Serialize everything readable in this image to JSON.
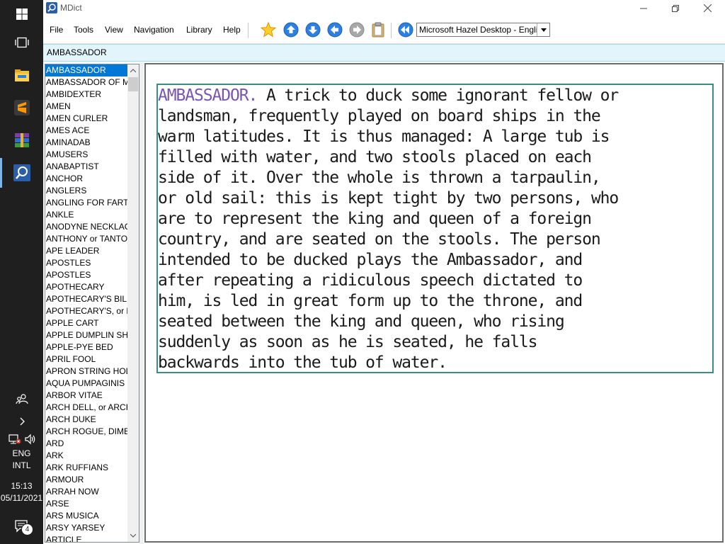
{
  "taskbar": {
    "clock_time": "15:13",
    "clock_date": "05/11/2021",
    "language_1": "ENG",
    "language_2": "INTL",
    "notification_count": "4"
  },
  "window": {
    "title": "MDict"
  },
  "menu": [
    "File",
    "Tools",
    "View",
    "Navigation",
    "Library",
    "Help"
  ],
  "toolbar": {
    "dictionary_selected": "Microsoft Hazel Desktop - English"
  },
  "search": {
    "value": "AMBASSADOR"
  },
  "wordlist": [
    "AMBASSADOR",
    "AMBASSADOR OF MOROCCO",
    "AMBIDEXTER",
    "AMEN",
    "AMEN CURLER",
    "AMES ACE",
    "AMINADAB",
    "AMUSERS",
    "ANABAPTIST",
    "ANCHOR",
    "ANGLERS",
    "ANGLING FOR FARTHINGS",
    "ANKLE",
    "ANODYNE NECKLACE",
    "ANTHONY or TANTONY PIG",
    "APE LEADER",
    "APOSTLES",
    "APOSTLES",
    "APOTHECARY",
    "APOTHECARY'S BILL",
    "APOTHECARY'S, or LAW LATIN",
    "APPLE CART",
    "APPLE DUMPLIN SHOP",
    "APPLE-PYE BED",
    "APRIL FOOL",
    "APRON STRING HOLD",
    "AQUA PUMPAGINIS",
    "ARBOR VITAE",
    "ARCH DELL, or ARCH DOXY",
    "ARCH DUKE",
    "ARCH ROGUE, DIMBER DAMBER",
    "ARD",
    "ARK",
    "ARK RUFFIANS",
    "ARMOUR",
    "ARRAH NOW",
    "ARSE",
    "ARS MUSICA",
    "ARSY YARSEY",
    "ARTICLE"
  ],
  "definition": {
    "headword": "AMBASSADOR.",
    "body": " A trick to duck some ignorant fellow or\nlandsman, frequently played on board ships in the\nwarm latitudes. It is thus managed: A large tub is\nfilled with water, and two stools placed on each\nside of it. Over the whole is thrown a tarpaulin,\nor old sail: this is kept tight by two persons, who\nare to represent the king and queen of a foreign\ncountry, and are seated on the stools. The person\nintended to be ducked plays the Ambassador, and\nafter repeating a ridiculous speech dictated to\nhim, is led in great form up to the throne, and\nseated between the king and queen, who rising\nsuddenly as soon as he is seated, he falls\nbackwards into the tub of water."
  },
  "colors": {
    "taskbar_bg": "#1f1f1f",
    "selection": "#0078d7",
    "search_bg": "#e3f5fc",
    "headword": "#7a55b0",
    "definition_border": "#3b8c82"
  }
}
